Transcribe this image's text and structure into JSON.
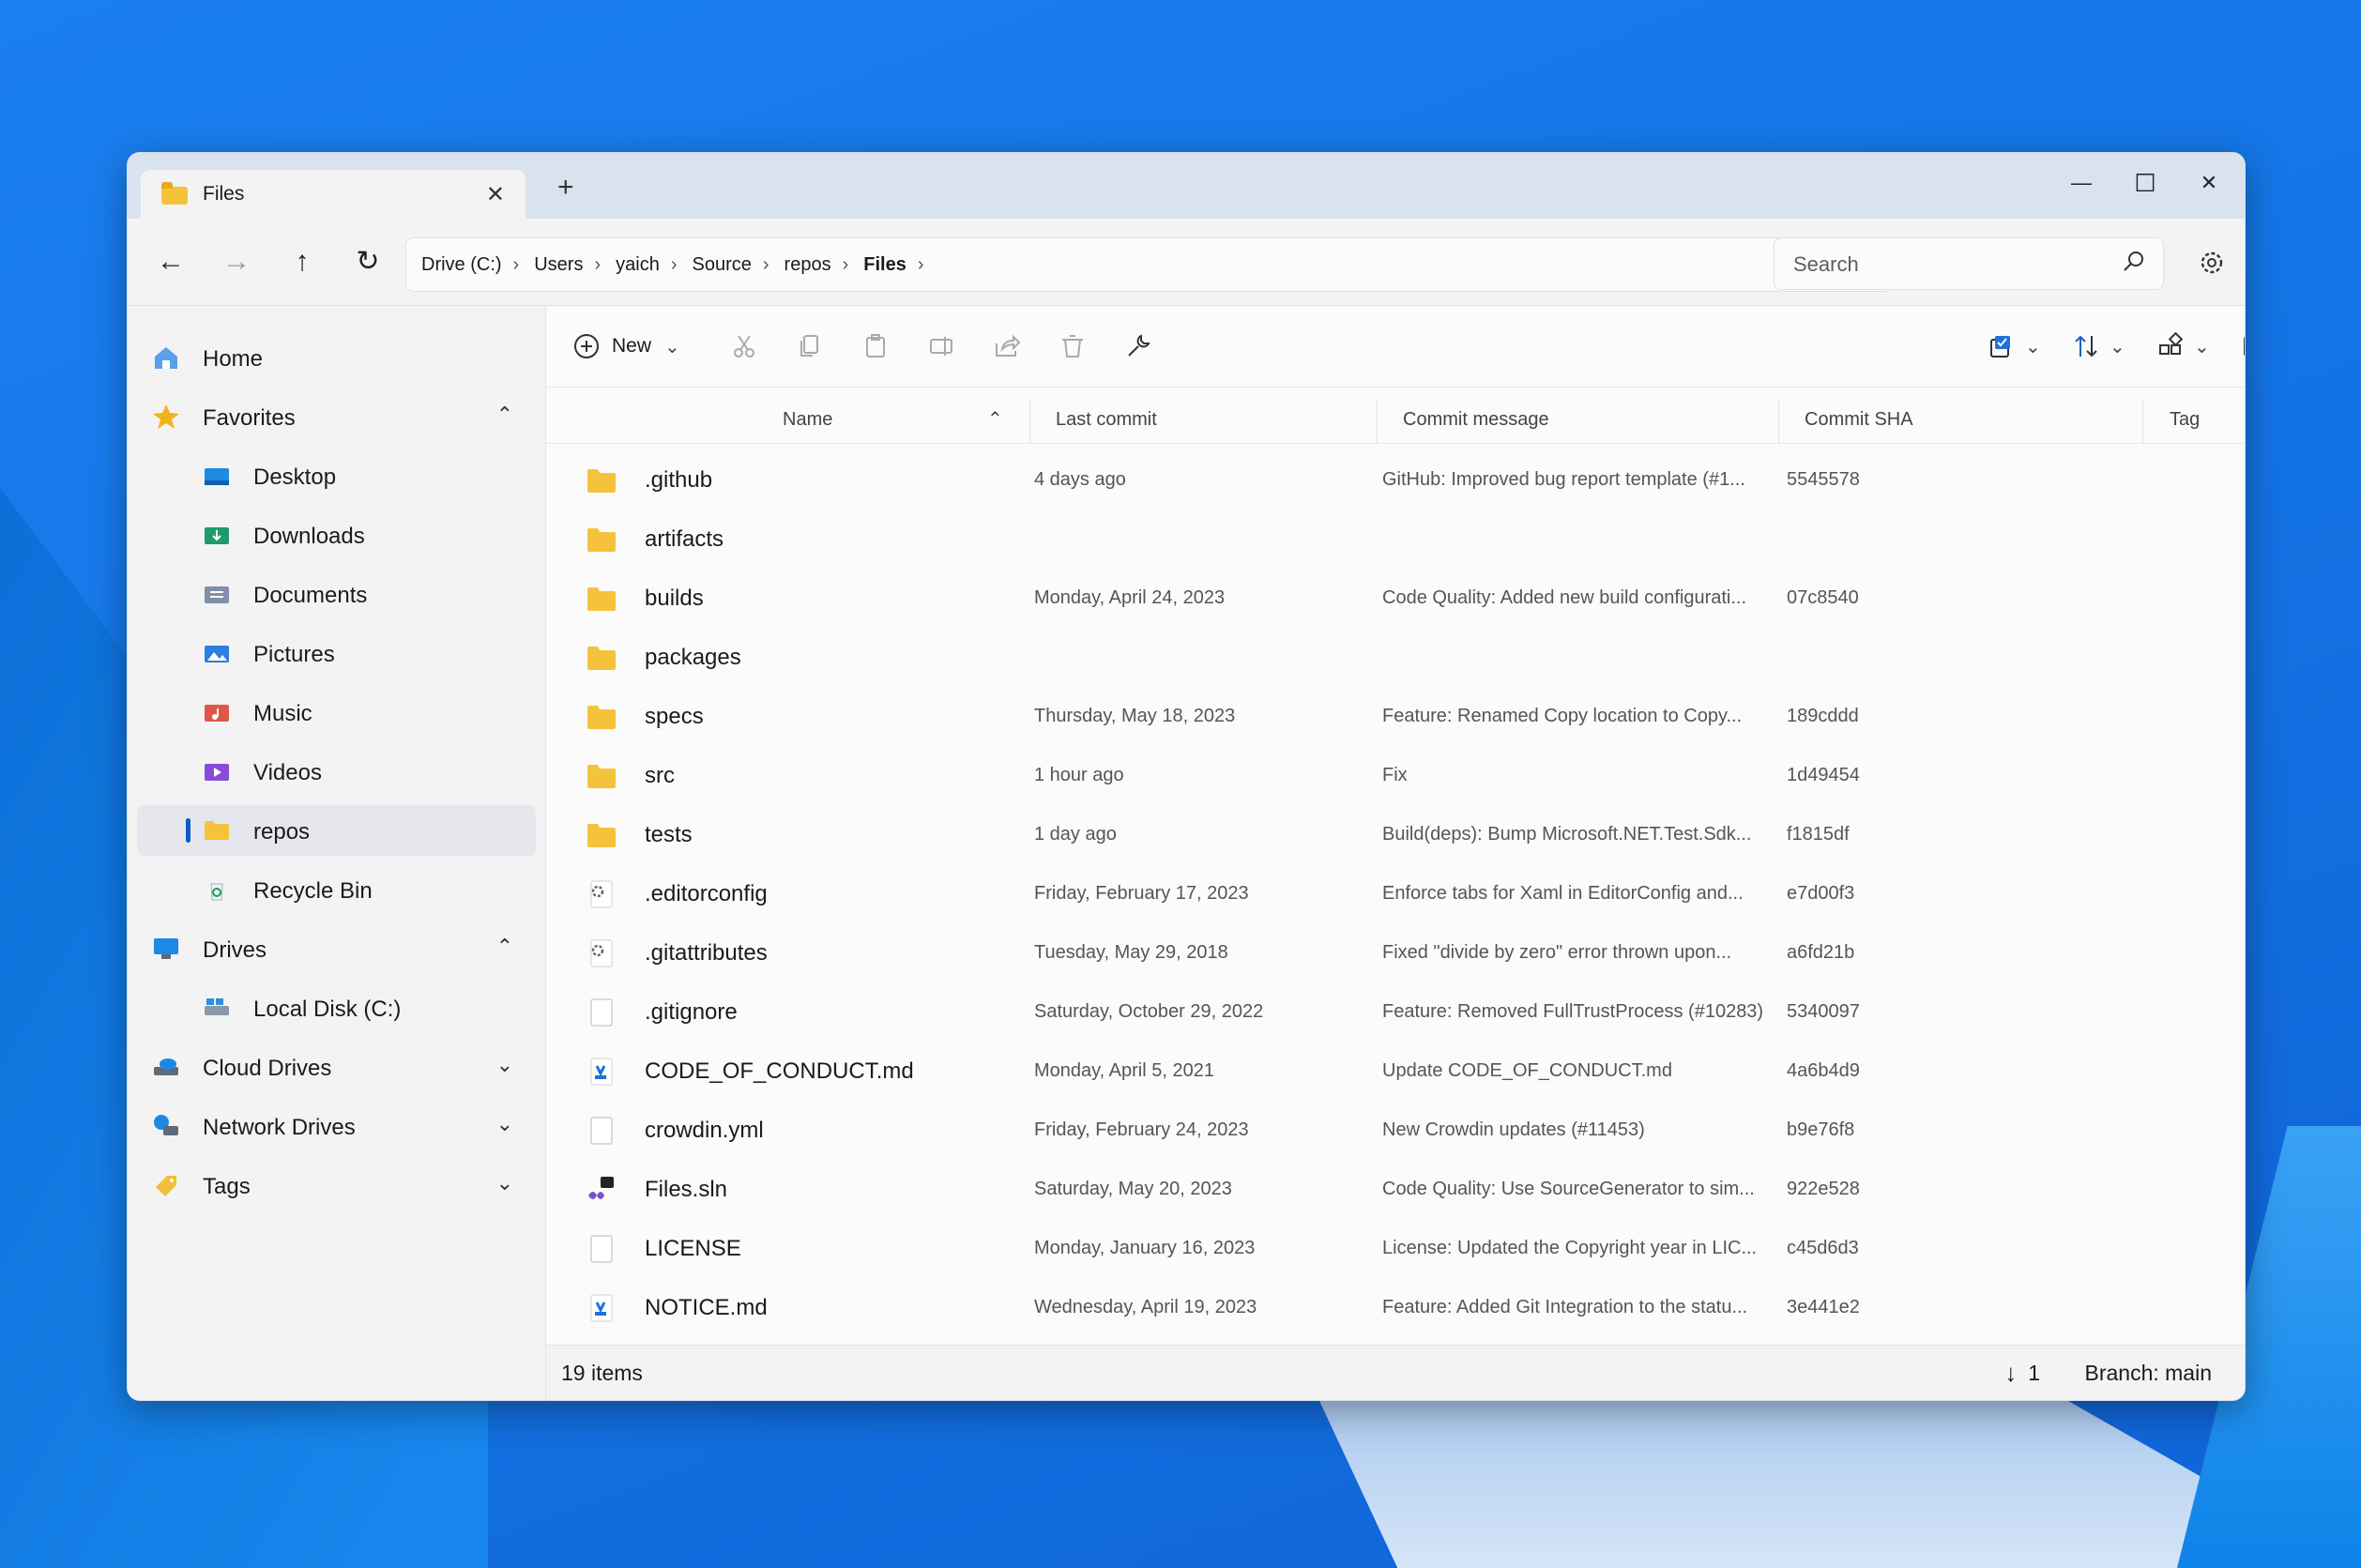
{
  "window": {
    "tab_title": "Files",
    "tab_close": "✕",
    "tab_add": "+",
    "minimize": "—",
    "maximize": "☐",
    "close": "✕"
  },
  "nav": {
    "back": "←",
    "forward": "→",
    "up": "↑",
    "refresh": "↻",
    "breadcrumb": [
      "Drive (C:)",
      "Users",
      "yaich",
      "Source",
      "repos",
      "Files"
    ],
    "search_placeholder": "Search"
  },
  "sidebar": {
    "items": [
      {
        "label": "Home",
        "icon": "home-icon"
      },
      {
        "label": "Favorites",
        "icon": "star-icon",
        "expanded": true
      },
      {
        "label": "Desktop",
        "icon": "desktop-folder-icon"
      },
      {
        "label": "Downloads",
        "icon": "downloads-folder-icon"
      },
      {
        "label": "Documents",
        "icon": "documents-folder-icon"
      },
      {
        "label": "Pictures",
        "icon": "pictures-folder-icon"
      },
      {
        "label": "Music",
        "icon": "music-folder-icon"
      },
      {
        "label": "Videos",
        "icon": "videos-folder-icon"
      },
      {
        "label": "repos",
        "icon": "folder-icon",
        "selected": true
      },
      {
        "label": "Recycle Bin",
        "icon": "recycle-bin-icon"
      },
      {
        "label": "Drives",
        "icon": "drives-icon",
        "expanded": true
      },
      {
        "label": "Local Disk (C:)",
        "icon": "local-disk-icon"
      },
      {
        "label": "Cloud Drives",
        "icon": "cloud-drive-icon",
        "expanded": false
      },
      {
        "label": "Network Drives",
        "icon": "network-drive-icon",
        "expanded": false
      },
      {
        "label": "Tags",
        "icon": "tag-icon",
        "expanded": false
      }
    ]
  },
  "toolbar": {
    "new_label": "New"
  },
  "columns": {
    "name": "Name",
    "last_commit": "Last commit",
    "commit_message": "Commit message",
    "commit_sha": "Commit SHA",
    "tag": "Tag"
  },
  "files": [
    {
      "name": ".github",
      "type": "folder",
      "date": "4 days ago",
      "message": "GitHub: Improved bug report template (#1...",
      "sha": "5545578"
    },
    {
      "name": "artifacts",
      "type": "folder",
      "date": "",
      "message": "",
      "sha": ""
    },
    {
      "name": "builds",
      "type": "folder",
      "date": "Monday, April 24, 2023",
      "message": "Code Quality: Added new build configurati...",
      "sha": "07c8540"
    },
    {
      "name": "packages",
      "type": "folder",
      "date": "",
      "message": "",
      "sha": ""
    },
    {
      "name": "specs",
      "type": "folder",
      "date": "Thursday, May 18, 2023",
      "message": "Feature: Renamed Copy location to Copy...",
      "sha": "189cddd"
    },
    {
      "name": "src",
      "type": "folder",
      "date": "1 hour ago",
      "message": "Fix",
      "sha": "1d49454"
    },
    {
      "name": "tests",
      "type": "folder",
      "date": "1 day ago",
      "message": "Build(deps): Bump Microsoft.NET.Test.Sdk...",
      "sha": "f1815df"
    },
    {
      "name": ".editorconfig",
      "type": "config",
      "date": "Friday, February 17, 2023",
      "message": "Enforce tabs for Xaml in EditorConfig and...",
      "sha": "e7d00f3"
    },
    {
      "name": ".gitattributes",
      "type": "config",
      "date": "Tuesday, May 29, 2018",
      "message": "Fixed \"divide by zero\" error thrown upon...",
      "sha": "a6fd21b"
    },
    {
      "name": ".gitignore",
      "type": "file",
      "date": "Saturday, October 29, 2022",
      "message": "Feature: Removed FullTrustProcess (#10283)",
      "sha": "5340097"
    },
    {
      "name": "CODE_OF_CONDUCT.md",
      "type": "markdown",
      "date": "Monday, April 5, 2021",
      "message": "Update CODE_OF_CONDUCT.md",
      "sha": "4a6b4d9"
    },
    {
      "name": "crowdin.yml",
      "type": "file",
      "date": "Friday, February 24, 2023",
      "message": "New Crowdin updates (#11453)",
      "sha": "b9e76f8"
    },
    {
      "name": "Files.sln",
      "type": "solution",
      "date": "Saturday, May 20, 2023",
      "message": "Code Quality: Use SourceGenerator to sim...",
      "sha": "922e528"
    },
    {
      "name": "LICENSE",
      "type": "file",
      "date": "Monday, January 16, 2023",
      "message": "License: Updated the Copyright year in LIC...",
      "sha": "c45d6d3"
    },
    {
      "name": "NOTICE.md",
      "type": "markdown",
      "date": "Wednesday, April 19, 2023",
      "message": "Feature: Added Git Integration to the statu...",
      "sha": "3e441e2"
    }
  ],
  "status": {
    "item_count": "19 items",
    "pull_count": "1",
    "branch": "Branch: main"
  },
  "colors": {
    "accent": "#0a5bc4",
    "folder": "#f5c33b"
  }
}
